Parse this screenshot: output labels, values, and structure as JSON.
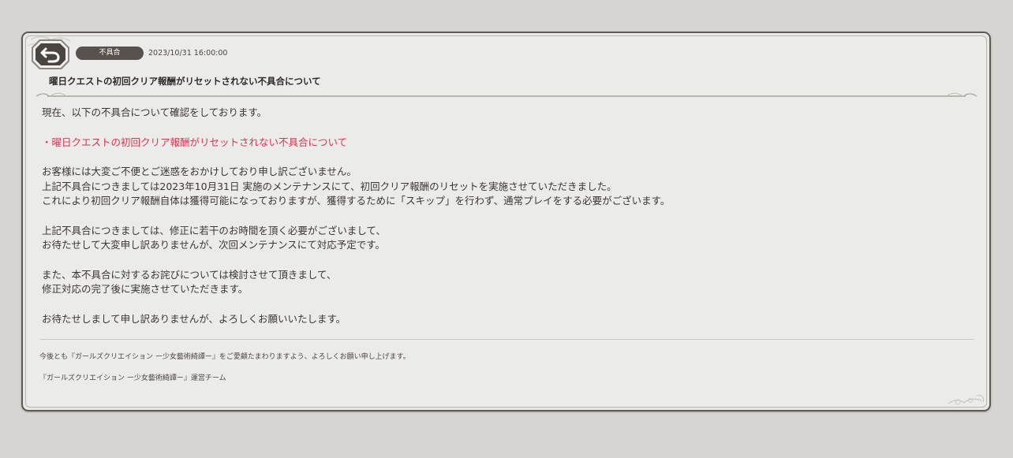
{
  "notice": {
    "category": "不具合",
    "datetime": "2023/10/31 16:00:00",
    "title": "曜日クエストの初回クリア報酬がリセットされない不具合について"
  },
  "body": {
    "intro": "現在、以下の不具合について確認をしております。",
    "highlight": "・曜日クエストの初回クリア報酬がリセットされない不具合について",
    "paragraph1": [
      "お客様には大変ご不便とご迷惑をおかけしており申し訳ございません。",
      "上記不具合につきましては2023年10月31日 実施のメンテナンスにて、初回クリア報酬のリセットを実施させていただきました。",
      "これにより初回クリア報酬自体は獲得可能になっておりますが、獲得するために「スキップ」を行わず、通常プレイをする必要がございます。"
    ],
    "paragraph2": [
      "上記不具合につきましては、修正に若干のお時間を頂く必要がございまして、",
      "お待たせして大変申し訳ありませんが、次回メンテナンスにて対応予定です。"
    ],
    "paragraph3": [
      "また、本不具合に対するお詫びについては検討させて頂きまして、",
      "修正対応の完了後に実施させていただきます。"
    ],
    "closing": "お待たせしまして申し訳ありませんが、よろしくお願いいたします。"
  },
  "footer": {
    "thanks": "今後とも『ガールズクリエイション ー少女藝術綺譚ー』をご愛顧たまわりますよう、よろしくお願い申し上げます。",
    "signature": "『ガールズクリエイション ー少女藝術綺譚ー』運営チーム"
  },
  "icons": {
    "back": "return-arrow-icon"
  },
  "colors": {
    "background": "#d6d5d1",
    "panel": "#ebebea",
    "border": "#5f5a56",
    "badge": "#58524e",
    "highlight_text": "#e0314f",
    "text": "#3b3633"
  }
}
